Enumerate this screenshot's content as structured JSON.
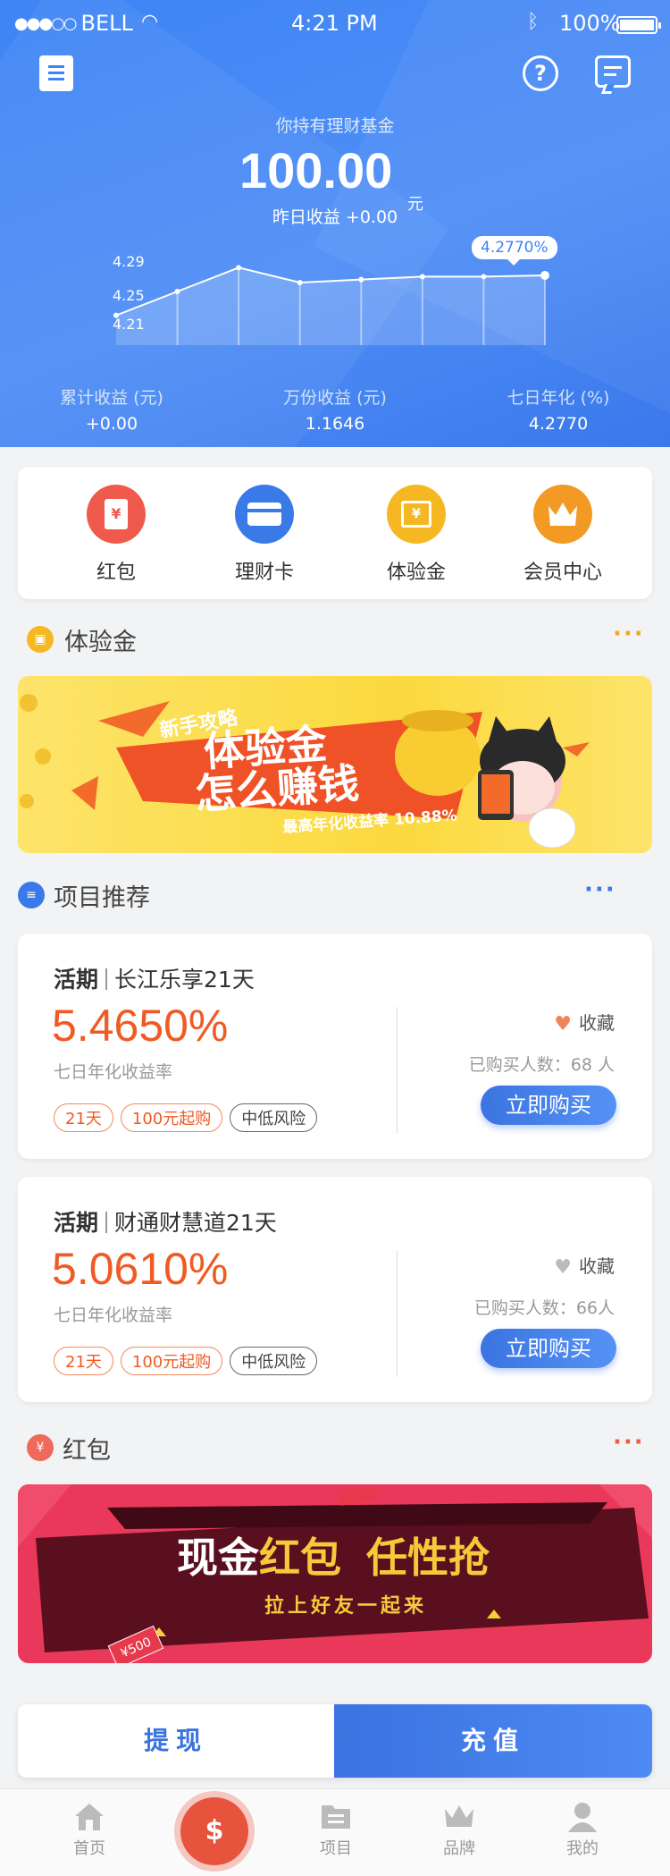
{
  "status_bar": {
    "carrier": "BELL",
    "time": "4:21 PM",
    "battery": "100%"
  },
  "header": {
    "holding_label": "你持有理财基金",
    "holding_amount": "100.00",
    "holding_unit": "元",
    "yesterday_label": "昨日收益 +0.00",
    "tooltip": "4.2770%"
  },
  "chart_data": {
    "type": "area",
    "x": [
      1,
      2,
      3,
      4,
      5,
      6,
      7,
      8
    ],
    "values": [
      4.21,
      4.25,
      4.29,
      4.265,
      4.27,
      4.275,
      4.275,
      4.277
    ],
    "ytick_labels": [
      "4.29",
      "4.25",
      "4.21"
    ],
    "highlight_label": "4.2770%"
  },
  "stats": [
    {
      "label": "累计收益 (元)",
      "value": "+0.00"
    },
    {
      "label": "万份收益 (元)",
      "value": "1.1646"
    },
    {
      "label": "七日年化 (%)",
      "value": "4.2770"
    }
  ],
  "quick_menu": [
    {
      "label": "红包",
      "icon": "red-packet-icon",
      "color": "#ef5a4c"
    },
    {
      "label": "理财卡",
      "icon": "card-icon",
      "color": "#3a7ae8"
    },
    {
      "label": "体验金",
      "icon": "ticket-icon",
      "color": "#f5b823"
    },
    {
      "label": "会员中心",
      "icon": "crown-icon",
      "color": "#f39a25"
    }
  ],
  "section_trial": {
    "title": "体验金",
    "more": "···"
  },
  "trial_banner": {
    "tag": "新手攻略",
    "line1": "体验金",
    "line2": "怎么赚钱",
    "rate": "最高年化收益率 10.88%"
  },
  "section_projects": {
    "title": "项目推荐",
    "more": "···"
  },
  "projects": [
    {
      "kind": "活期",
      "name": "长江乐享21天",
      "rate": "5.4650%",
      "rate_label": "七日年化收益率",
      "tags": [
        "21天",
        "100元起购",
        "中低风险"
      ],
      "fav_label": "收藏",
      "buyers": "已购买人数：68 人",
      "buy_label": "立即购买"
    },
    {
      "kind": "活期",
      "name": "财通财慧道21天",
      "rate": "5.0610%",
      "rate_label": "七日年化收益率",
      "tags": [
        "21天",
        "100元起购",
        "中低风险"
      ],
      "fav_label": "收藏",
      "buyers": "已购买人数：66人",
      "buy_label": "立即购买"
    }
  ],
  "section_redpacket": {
    "title": "红包",
    "more": "···"
  },
  "red_banner": {
    "line1a": "现金",
    "line1b": "红包",
    "line1c": "任性抢",
    "line2": "拉上好友一起来",
    "coupon": "¥500"
  },
  "actions": {
    "withdraw": "提现",
    "recharge": "充值"
  },
  "tabbar": [
    {
      "label": "首页",
      "icon": "home-icon"
    },
    {
      "label": "",
      "icon": "money-bag-icon"
    },
    {
      "label": "项目",
      "icon": "folder-icon"
    },
    {
      "label": "品牌",
      "icon": "crown-icon"
    },
    {
      "label": "我的",
      "icon": "user-icon"
    }
  ],
  "colors": {
    "primary": "#3f84f5",
    "orange": "#f05a23",
    "red": "#e9385a"
  }
}
